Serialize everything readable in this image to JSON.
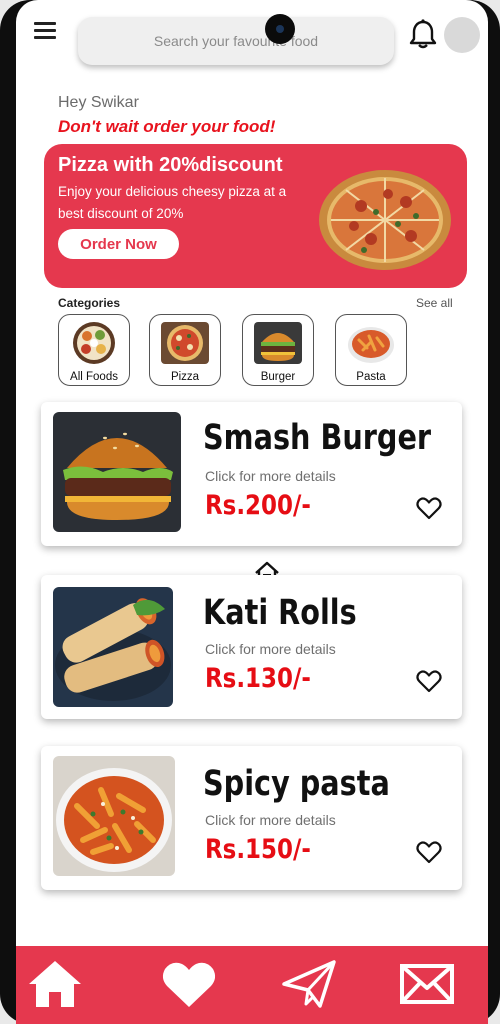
{
  "header": {
    "search_placeholder": "Search your favourite food"
  },
  "greeting": {
    "hello": "Hey Swikar",
    "tagline": "Don't wait order your food!"
  },
  "banner": {
    "title": "Pizza with 20%discount",
    "text": "Enjoy your delicious cheesy pizza at a best discount of 20%",
    "button": "Order Now"
  },
  "categories": {
    "label": "Categories",
    "see_all": "See all",
    "items": [
      {
        "name": "All Foods"
      },
      {
        "name": "Pizza"
      },
      {
        "name": "Burger"
      },
      {
        "name": "Pasta"
      }
    ]
  },
  "foods": [
    {
      "name": "Smash Burger",
      "subtitle": "Click for more details",
      "price": "Rs.200/-"
    },
    {
      "name": "Kati Rolls",
      "subtitle": "Click for more details",
      "price": "Rs.130/-"
    },
    {
      "name": "Spicy pasta",
      "subtitle": "Click for more details",
      "price": "Rs.150/-"
    }
  ],
  "nav": {
    "items": [
      "home-icon",
      "heart-icon",
      "send-icon",
      "mail-icon"
    ]
  },
  "colors": {
    "accent": "#e5384e",
    "price": "#e60d14",
    "tagline": "#e8131e"
  }
}
